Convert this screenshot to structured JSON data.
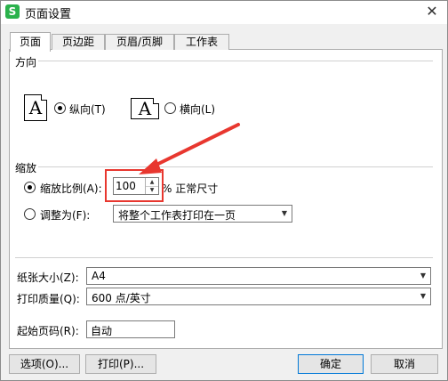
{
  "window": {
    "title": "页面设置",
    "app_icon": "S",
    "close_glyph": "✕"
  },
  "tabs": [
    "页面",
    "页边距",
    "页眉/页脚",
    "工作表"
  ],
  "orientation": {
    "section": "方向",
    "icon_letter": "A",
    "portrait_label": "纵向(T)",
    "landscape_label": "横向(L)",
    "selected": "portrait"
  },
  "scaling": {
    "section": "缩放",
    "scale_label": "缩放比例(A):",
    "scale_value": "100",
    "scale_suffix": "% 正常尺寸",
    "fit_label": "调整为(F):",
    "fit_value": "将整个工作表打印在一页",
    "selected": "scale"
  },
  "paper": {
    "size_label": "纸张大小(Z):",
    "size_value": "A4",
    "quality_label": "打印质量(Q):",
    "quality_value": "600 点/英寸"
  },
  "start_page": {
    "label": "起始页码(R):",
    "value": "自动"
  },
  "buttons": {
    "options": "选项(O)...",
    "print": "打印(P)...",
    "ok": "确定",
    "cancel": "取消"
  },
  "annotation": {
    "color": "#e8372f"
  }
}
